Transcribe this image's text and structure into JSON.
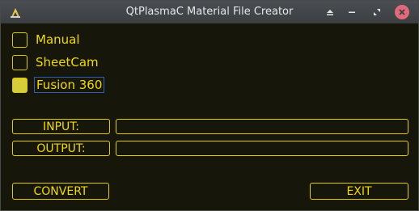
{
  "window": {
    "title": "QtPlasmaC Material File Creator",
    "controls": [
      "shade",
      "minimize",
      "maximize",
      "close"
    ]
  },
  "sources": [
    {
      "label": "Manual",
      "checked": false
    },
    {
      "label": "SheetCam",
      "checked": false
    },
    {
      "label": "Fusion 360",
      "checked": true,
      "focused": true
    }
  ],
  "io": {
    "input_label": "INPUT:",
    "input_value": "",
    "output_label": "OUTPUT:",
    "output_value": ""
  },
  "actions": {
    "convert_label": "CONVERT",
    "exit_label": "EXIT"
  },
  "colors": {
    "accent": "#f2da00",
    "background": "#16160b",
    "checked_fill": "#d7cc3a",
    "focus_border": "#2f5db5",
    "close_button": "#e0697b"
  }
}
